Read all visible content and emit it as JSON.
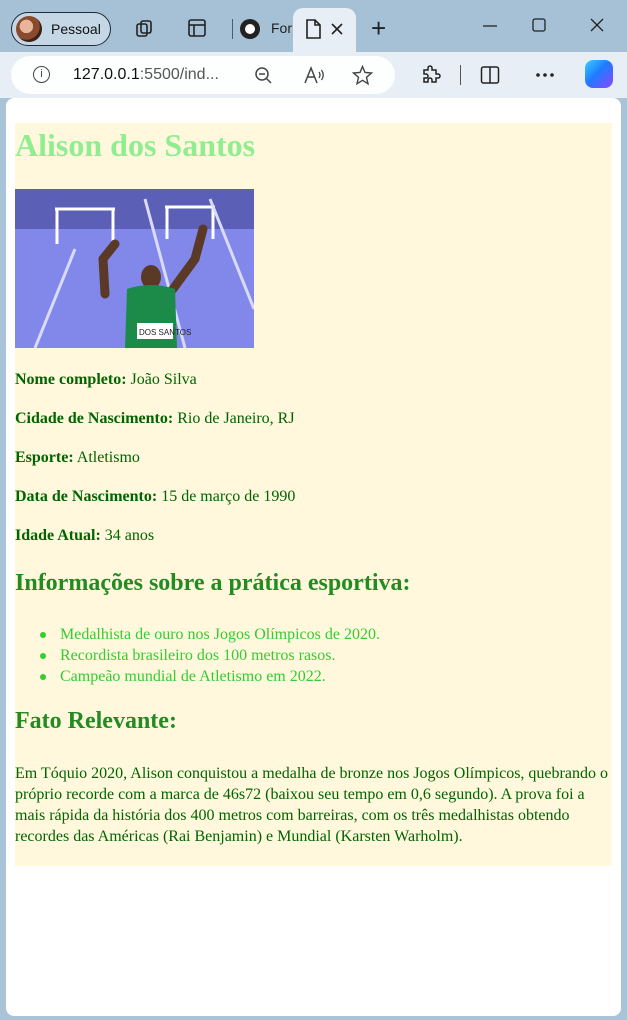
{
  "browser": {
    "profile_label": "Pessoal",
    "inactive_tab_label": "For",
    "url_host": "127.0.0.1",
    "url_rest": ":5500/ind...",
    "colors": {
      "titlebar": "#a6c0d6",
      "toolbar": "#e7eef5",
      "active_tab": "#e7eef5"
    }
  },
  "page": {
    "name": "Alison dos Santos",
    "info": [
      {
        "label": "Nome completo:",
        "value": "João Silva"
      },
      {
        "label": "Cidade de Nascimento:",
        "value": "Rio de Janeiro, RJ"
      },
      {
        "label": "Esporte:",
        "value": "Atletismo"
      },
      {
        "label": "Data de Nascimento:",
        "value": "15 de março de 1990"
      },
      {
        "label": "Idade Atual:",
        "value": "34 anos"
      }
    ],
    "practice_heading": "Informações sobre a prática esportiva:",
    "practice_items": [
      "Medalhista de ouro nos Jogos Olímpicos de 2020.",
      "Recordista brasileiro dos 100 metros rasos.",
      "Campeão mundial de Atletismo em 2022."
    ],
    "fact_heading": "Fato Relevante:",
    "fact_text": "Em Tóquio 2020, Alison conquistou a medalha de bronze nos Jogos Olímpicos, quebrando o próprio recorde com a marca de 46s72 (baixou seu tempo em 0,6 segundo). A prova foi a mais rápida da história dos 400 metros com barreiras, com os três medalhistas obtendo recordes das Américas (Rai Benjamin) e Mundial (Karsten Warholm).",
    "photo_bib": "DOS SANTOS",
    "colors": {
      "background": "#fff8dc",
      "name": "#90ee90",
      "text": "#006400",
      "heading": "#228b22",
      "list": "#32cd32"
    }
  }
}
